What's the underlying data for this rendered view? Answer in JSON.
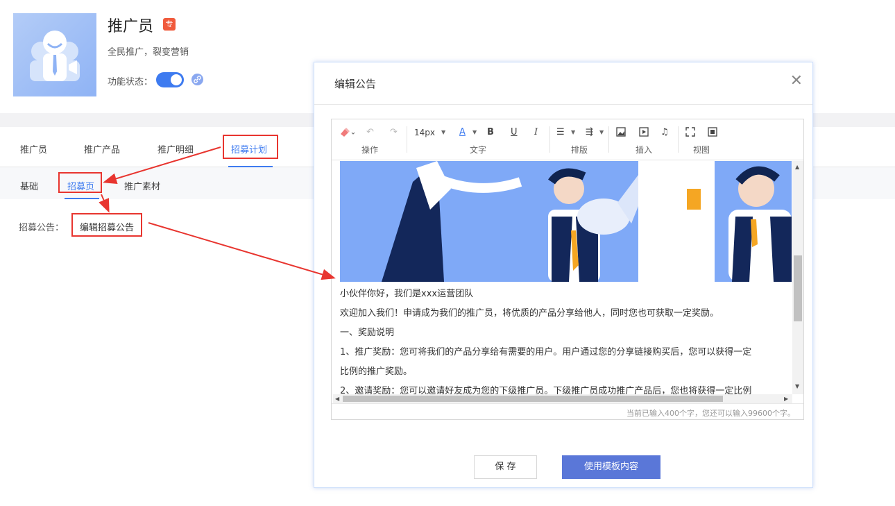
{
  "app": {
    "title": "推广员",
    "badge": "专",
    "subtitle": "全民推广，裂变营销",
    "status_label": "功能状态：",
    "status_enabled": true
  },
  "main_tabs": [
    {
      "label": "推广员",
      "active": false
    },
    {
      "label": "推广产品",
      "active": false
    },
    {
      "label": "推广明细",
      "active": false
    },
    {
      "label": "招募计划",
      "active": true
    }
  ],
  "sub_tabs": [
    {
      "label": "基础",
      "active": false
    },
    {
      "label": "招募页",
      "active": true
    },
    {
      "label": "推广素材",
      "active": false
    }
  ],
  "recruit_notice": {
    "label": "招募公告：",
    "link_text": "编辑招募公告"
  },
  "modal": {
    "title": "编辑公告",
    "close_icon": "close-icon",
    "toolbar": {
      "font_size": "14px",
      "groups": [
        "操作",
        "文字",
        "排版",
        "插入",
        "视图"
      ]
    },
    "content_lines": [
      "小伙伴你好，我们是xxx运营团队",
      "欢迎加入我们！申请成为我们的推广员，将优质的产品分享给他人，同时您也可获取一定奖励。",
      "一、奖励说明",
      "1、推广奖励：您可将我们的产品分享给有需要的用户。用户通过您的分享链接购买后，您可以获得一定",
      "比例的推广奖励。",
      "2、邀请奖励：您可以邀请好友成为您的下级推广员。下级推广员成功推广产品后，您也将获得一定比例"
    ],
    "char_count": "当前已输入400个字，您还可以输入99600个字。",
    "save_label": "保 存",
    "template_label": "使用模板内容"
  },
  "colors": {
    "accent": "#3e7bf0",
    "annotation": "#e8352f",
    "primary_button": "#5a77d8"
  }
}
